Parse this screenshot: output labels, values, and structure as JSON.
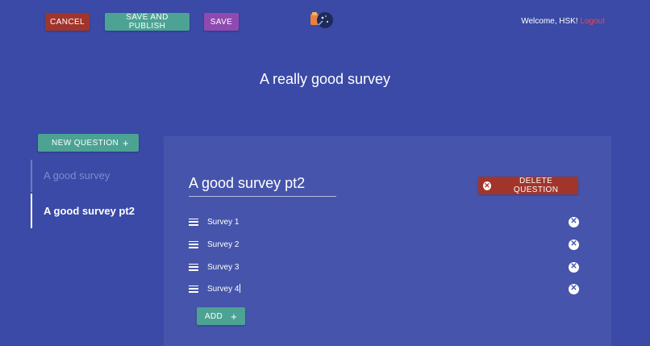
{
  "topbar": {
    "cancel_label": "Cancel",
    "publish_label": "Save and Publish",
    "save_label": "Save",
    "welcome_text": "Welcome, HSK!",
    "logout_label": "Logout"
  },
  "survey": {
    "title": "A really good survey"
  },
  "sidebar": {
    "new_question_label": "New Question",
    "new_question_icon": "plus-icon",
    "items": [
      {
        "label": "A good survey",
        "active": false
      },
      {
        "label": "A good survey pt2",
        "active": true
      }
    ]
  },
  "question": {
    "title": "A good survey pt2",
    "delete_label": "Delete Question",
    "delete_icon": "close-circle-icon",
    "options": [
      {
        "label": "Survey 1"
      },
      {
        "label": "Survey 2"
      },
      {
        "label": "Survey 3"
      },
      {
        "label": "Survey 4"
      }
    ],
    "add_label": "Add",
    "add_icon": "plus-icon",
    "drag_icon": "drag-handle-icon",
    "remove_icon": "close-circle-icon"
  },
  "colors": {
    "background": "#3a4aa6",
    "panel": "#4655ab",
    "cancel": "#a1352b",
    "teal": "#4ca394",
    "save": "#8f4ab0",
    "logout": "#e04a5a"
  }
}
